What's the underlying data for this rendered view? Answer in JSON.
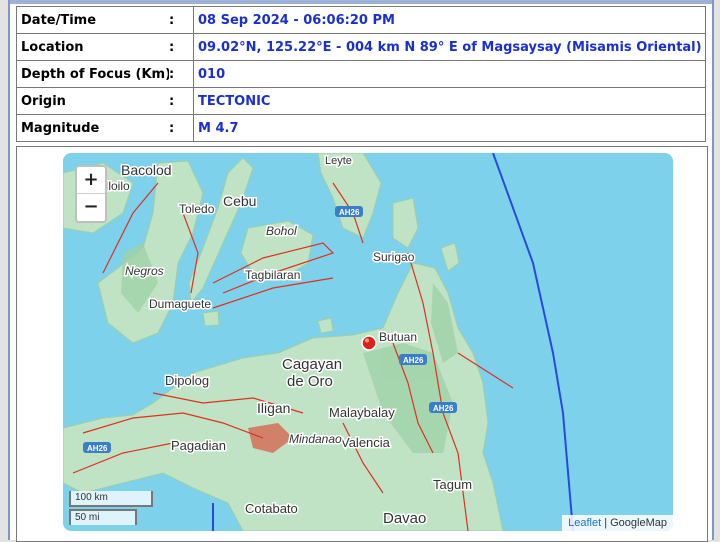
{
  "info": {
    "rows": [
      {
        "label": "Date/Time",
        "sep": ":",
        "value": "08 Sep 2024 - 06:06:20 PM"
      },
      {
        "label": "Location",
        "sep": ":",
        "value": "09.02°N, 125.22°E - 004 km N 89° E of Magsaysay (Misamis Oriental)"
      },
      {
        "label": "Depth of Focus (Km)",
        "sep": ":",
        "value": "010"
      },
      {
        "label": "Origin",
        "sep": ":",
        "value": "TECTONIC"
      },
      {
        "label": "Magnitude",
        "sep": ":",
        "value": "M 4.7"
      }
    ]
  },
  "map": {
    "zoom_in": "+",
    "zoom_out": "−",
    "scale_km": "100 km",
    "scale_mi": "50 mi",
    "attribution_link": "Leaflet",
    "attribution_sep": " | ",
    "attribution_provider": "GoogleMap",
    "cities": {
      "bacolod": "Bacolod",
      "iloilo": "Iloilo",
      "toledo": "Toledo",
      "cebu": "Cebu",
      "leyte": "Leyte",
      "bohol": "Bohol",
      "tagbilaran": "Tagbilaran",
      "negros": "Negros",
      "dumaguete": "Dumaguete",
      "surigao": "Surigao",
      "butuan": "Butuan",
      "cagayan": "Cagayan",
      "de_oro": "de Oro",
      "dipolog": "Dipolog",
      "iligan": "Iligan",
      "malaybalay": "Malaybalay",
      "valencia": "Valencia",
      "pagadian": "Pagadian",
      "mindanao": "Mindanao",
      "tagum": "Tagum",
      "cotabato": "Cotabato",
      "davao": "Davao"
    },
    "highways": {
      "ah26_a": "AH26",
      "ah26_b": "AH26",
      "ah26_c": "AH26",
      "ah26_d": "AH26"
    },
    "colors": {
      "sea": "#7dd1eb",
      "land": "#bfe3c4",
      "fault": "#e03020",
      "trench": "#2a48e0",
      "marker": "#e0201a"
    }
  }
}
